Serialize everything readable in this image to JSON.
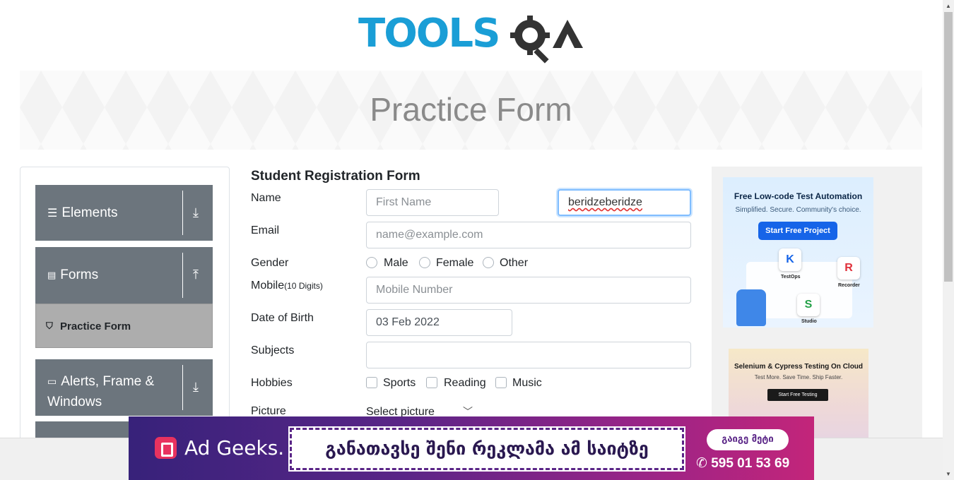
{
  "logo": {
    "text": "TOOLSQA"
  },
  "banner": {
    "title": "Practice Form"
  },
  "sidebar": {
    "groups": [
      {
        "label": "Elements",
        "icon": "menu-icon",
        "arrow": "download-arrow-icon"
      },
      {
        "label": "Forms",
        "icon": "document-icon",
        "arrow": "upload-arrow-icon"
      },
      {
        "label": "Alerts, Frame &",
        "label2": "Windows",
        "icon": "window-icon",
        "arrow": "download-arrow-icon"
      }
    ],
    "active_item": "Practice Form"
  },
  "form": {
    "title": "Student Registration Form",
    "name_label": "Name",
    "first_name_placeholder": "First Name",
    "last_name_value": "beridzeberidze",
    "email_label": "Email",
    "email_placeholder": "name@example.com",
    "gender_label": "Gender",
    "gender_options": [
      "Male",
      "Female",
      "Other"
    ],
    "mobile_label": "Mobile",
    "mobile_hint": "(10 Digits)",
    "mobile_placeholder": "Mobile Number",
    "dob_label": "Date of Birth",
    "dob_value": "03 Feb 2022",
    "subjects_label": "Subjects",
    "hobbies_label": "Hobbies",
    "hobbies_options": [
      "Sports",
      "Reading",
      "Music"
    ],
    "picture_label": "Picture",
    "picture_select": "Select picture"
  },
  "ads": {
    "ad1": {
      "title": "Free Low-code Test Automation",
      "subtitle": "Simplified. Secure. Community's choice.",
      "button": "Start Free Project",
      "tiles": [
        "TestOps",
        "Recorder",
        "Studio"
      ]
    },
    "ad2": {
      "title": "Selenium & Cypress Testing On Cloud",
      "subtitle": "Test More. Save Time. Ship Faster.",
      "button": "Start Free Testing"
    },
    "bottom": {
      "brand": "Ad Geeks.",
      "message": "განათავსე შენი რეკლამა ამ საიტზე",
      "button": "გაიგე მეტი",
      "phone": "595 01 53 69"
    }
  },
  "colors": {
    "sidebar_group": "#6c757d",
    "active_item": "#adadad",
    "logo_blue": "#1a9ed6",
    "focus_border": "#80bdff"
  }
}
